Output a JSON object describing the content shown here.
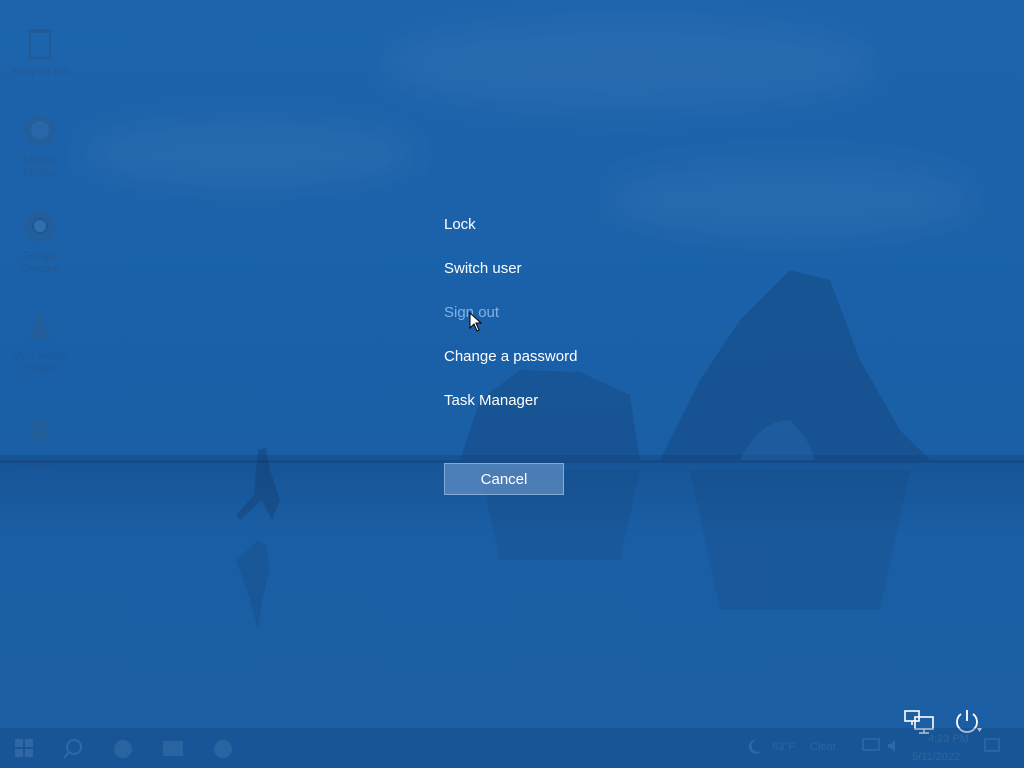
{
  "desktop": {
    "icons": [
      {
        "label": "Recycle Bin",
        "icon": "recycle-bin-icon"
      },
      {
        "label": "Mozilla Firefox",
        "icon": "firefox-icon"
      },
      {
        "label": "Google Chrome",
        "icon": "chrome-icon"
      },
      {
        "label": "VLC media player",
        "icon": "vlc-icon"
      },
      {
        "label": "Notepad++",
        "icon": "notepadpp-icon"
      }
    ]
  },
  "security_menu": {
    "items": [
      {
        "label": "Lock"
      },
      {
        "label": "Switch user"
      },
      {
        "label": "Sign out"
      },
      {
        "label": "Change a password"
      },
      {
        "label": "Task Manager"
      }
    ],
    "cancel_label": "Cancel"
  },
  "corner_icons": {
    "network": "network-icon",
    "power": "power-icon"
  },
  "taskbar": {
    "weather_temp": "63°F",
    "weather_condition": "Clear",
    "time": "4:23 PM",
    "date": "5/11/2022"
  },
  "colors": {
    "overlay": "#1b62ab",
    "hover_text": "#7fb3e6",
    "text": "#ffffff"
  }
}
